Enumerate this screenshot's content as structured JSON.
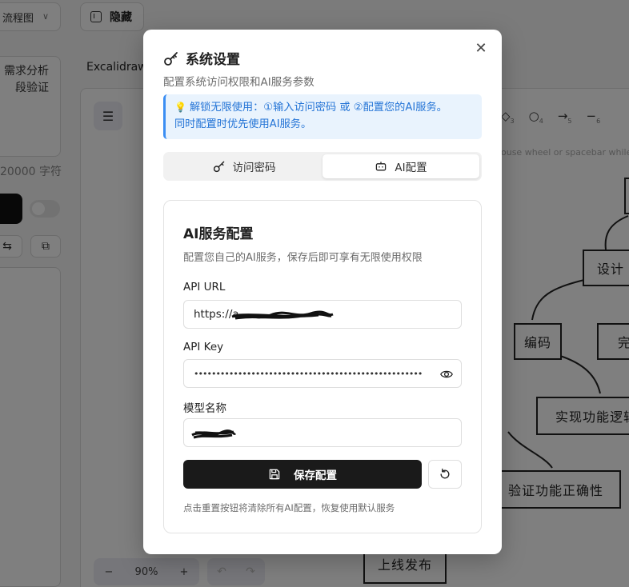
{
  "app": {
    "chart_type_select": "流程图",
    "hide_button": "隐藏",
    "requirement_text": [
      "需求分析",
      "段验证"
    ],
    "char_count": "20000 字符",
    "tab_label": "Excalidraw",
    "canvas_hint": "ouse wheel or spacebar while d",
    "zoom_level": "90%",
    "zoom_out": "−",
    "zoom_in": "+",
    "tool_numbers": [
      "3",
      "4",
      "5",
      "6"
    ],
    "diagram_nodes": {
      "design": "设计",
      "coding": "编码",
      "partial": "完",
      "implement": "实现功能逻辑",
      "verify": "验证功能正确性",
      "release": "上线发布"
    }
  },
  "modal": {
    "title": "系统设置",
    "subtitle": "配置系统访问权限和AI服务参数",
    "notice_line1": "解锁无限使用：①输入访问密码 或 ②配置您的AI服务。",
    "notice_line2": "同时配置时优先使用AI服务。",
    "tabs": [
      {
        "label": "访问密码",
        "icon": "key-icon"
      },
      {
        "label": "AI配置",
        "icon": "robot-icon"
      }
    ],
    "active_tab": "AI配置",
    "card": {
      "title": "AI服务配置",
      "description": "配置您自己的AI服务，保存后即可享有无限使用权限",
      "api_url_label": "API URL",
      "api_url_value": "https://a",
      "api_key_label": "API Key",
      "api_key_value": "••••••••••••••••••••••••••••••••••••••••••••••••••••",
      "model_label": "模型名称",
      "model_value": "",
      "save_label": "保存配置",
      "footnote": "点击重置按钮将清除所有AI配置，恢复使用默认服务"
    },
    "accent": "#2474d6"
  }
}
